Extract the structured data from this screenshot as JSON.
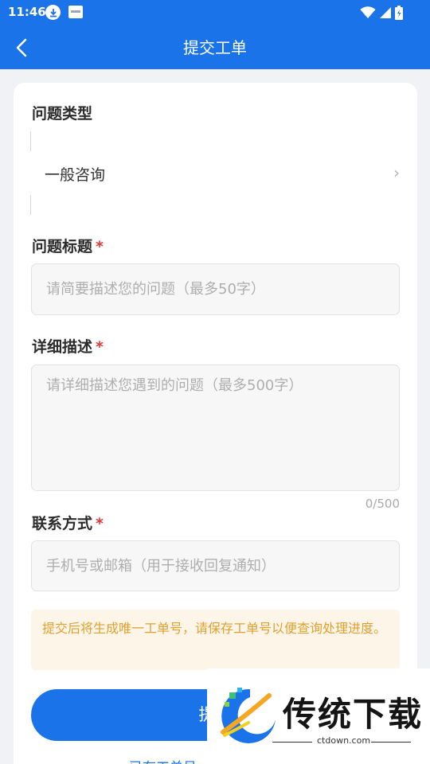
{
  "status_bar": {
    "time": "11:46",
    "icons": [
      "download-icon",
      "app-thumbnail-icon",
      "wifi-icon",
      "signal-icon",
      "battery-icon"
    ]
  },
  "nav": {
    "back_icon": "back-arrow-icon",
    "title": "提交工单"
  },
  "form": {
    "type_label": "问题类型",
    "type_value": "一般咨询",
    "type_arrow": "›",
    "title_label": "问题标题",
    "title_placeholder": "请简要描述您的问题（最多50字）",
    "detail_label": "详细描述",
    "detail_placeholder": "请详细描述您遇到的问题（最多500字）",
    "detail_counter": "0/500",
    "contact_label": "联系方式",
    "contact_placeholder": "手机号或邮箱（用于接收回复通知）",
    "required_mark": "*"
  },
  "notice": {
    "text": "提交后将生成唯一工单号，请保存工单号以便查询处理进度。"
  },
  "submit": {
    "label": "提交"
  },
  "link": {
    "label": "已有工单号"
  },
  "watermark": {
    "name": "传统下载",
    "url": "ctdown.com"
  },
  "colors": {
    "primary": "#1a73e8",
    "required": "#e53935",
    "notice_bg": "#fdf6e8",
    "notice_text": "#e0a030"
  }
}
